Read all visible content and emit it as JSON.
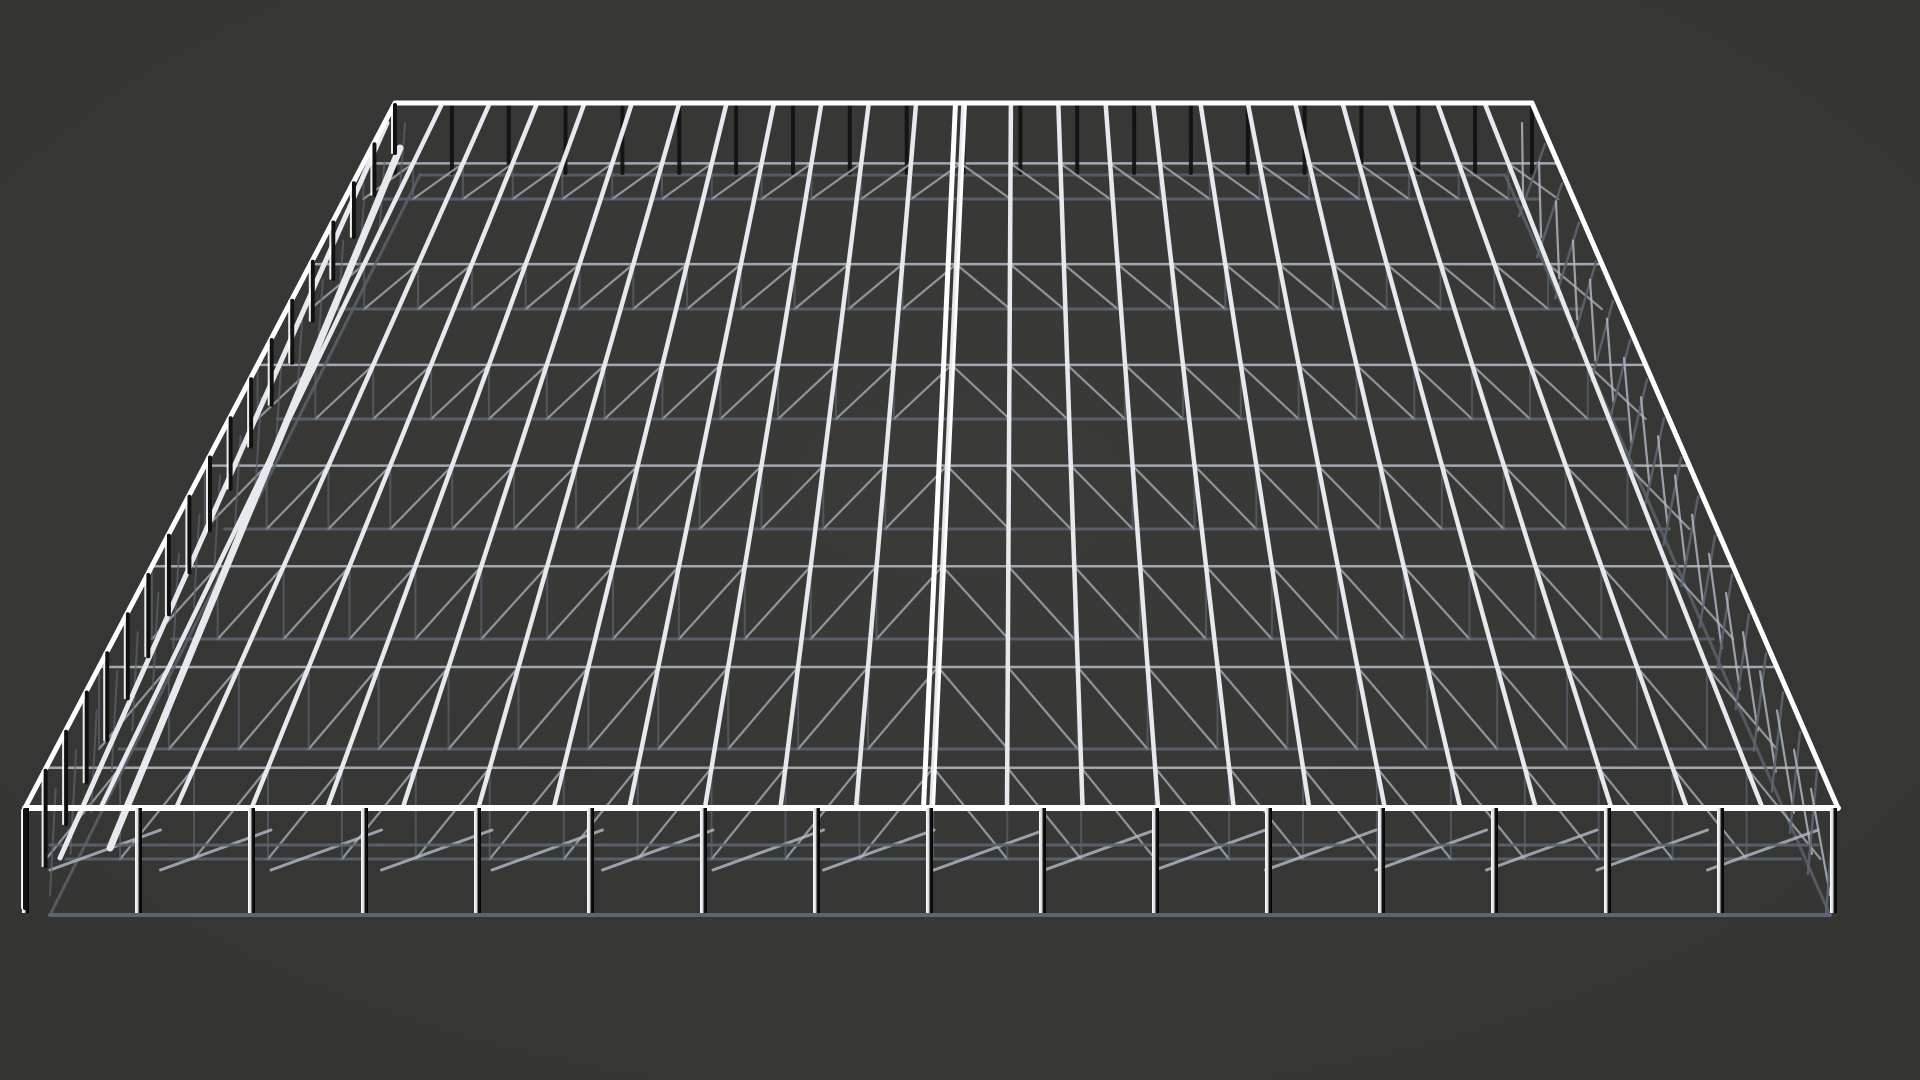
{
  "scene": {
    "subject": "steel-frame-structure",
    "view": "isometric-3d-render",
    "background_color": "#343432",
    "background_center_color": "#3a3a38",
    "frame_color_bright": "#ffffff",
    "frame_color_lit": "#e6e9ee",
    "frame_color_mid": "#b4bcc8",
    "frame_color_shadow": "#5c6470",
    "post_color_dark": "#111111",
    "roof_rafter_count": 25,
    "roof_purlin_rows": 7,
    "bay_count_front": 16,
    "bay_count_side": 18,
    "has_center_ridge": true,
    "has_perimeter_posts": true,
    "has_diagonal_bracing": true
  }
}
